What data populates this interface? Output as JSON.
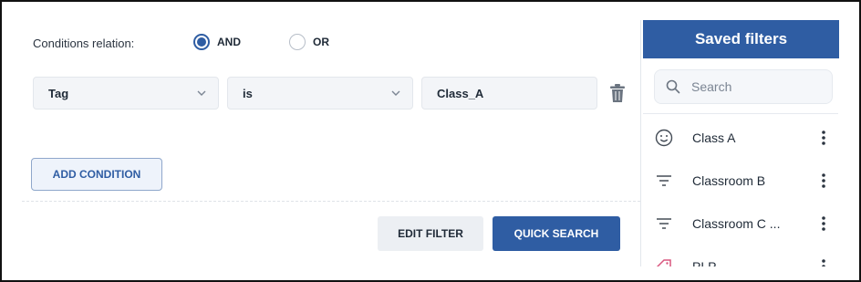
{
  "conditions": {
    "relation_label": "Conditions relation:",
    "options": [
      {
        "label": "AND",
        "selected": true
      },
      {
        "label": "OR",
        "selected": false
      }
    ],
    "rows": [
      {
        "field": "Tag",
        "operator": "is",
        "value": "Class_A"
      }
    ]
  },
  "actions": {
    "add_condition": "ADD CONDITION",
    "edit_filter": "EDIT FILTER",
    "quick_search": "QUICK SEARCH"
  },
  "saved_filters": {
    "title": "Saved filters",
    "search_placeholder": "Search",
    "items": [
      {
        "label": "Class A",
        "icon": "smiley-icon"
      },
      {
        "label": "Classroom B",
        "icon": "filter-lines-icon"
      },
      {
        "label": "Classroom C ...",
        "icon": "filter-lines-icon"
      },
      {
        "label": "PLP",
        "icon": "tag-icon"
      }
    ]
  },
  "colors": {
    "primary": "#2f5da3",
    "button_secondary_bg": "#eceff3",
    "field_bg": "#f3f5f8"
  }
}
